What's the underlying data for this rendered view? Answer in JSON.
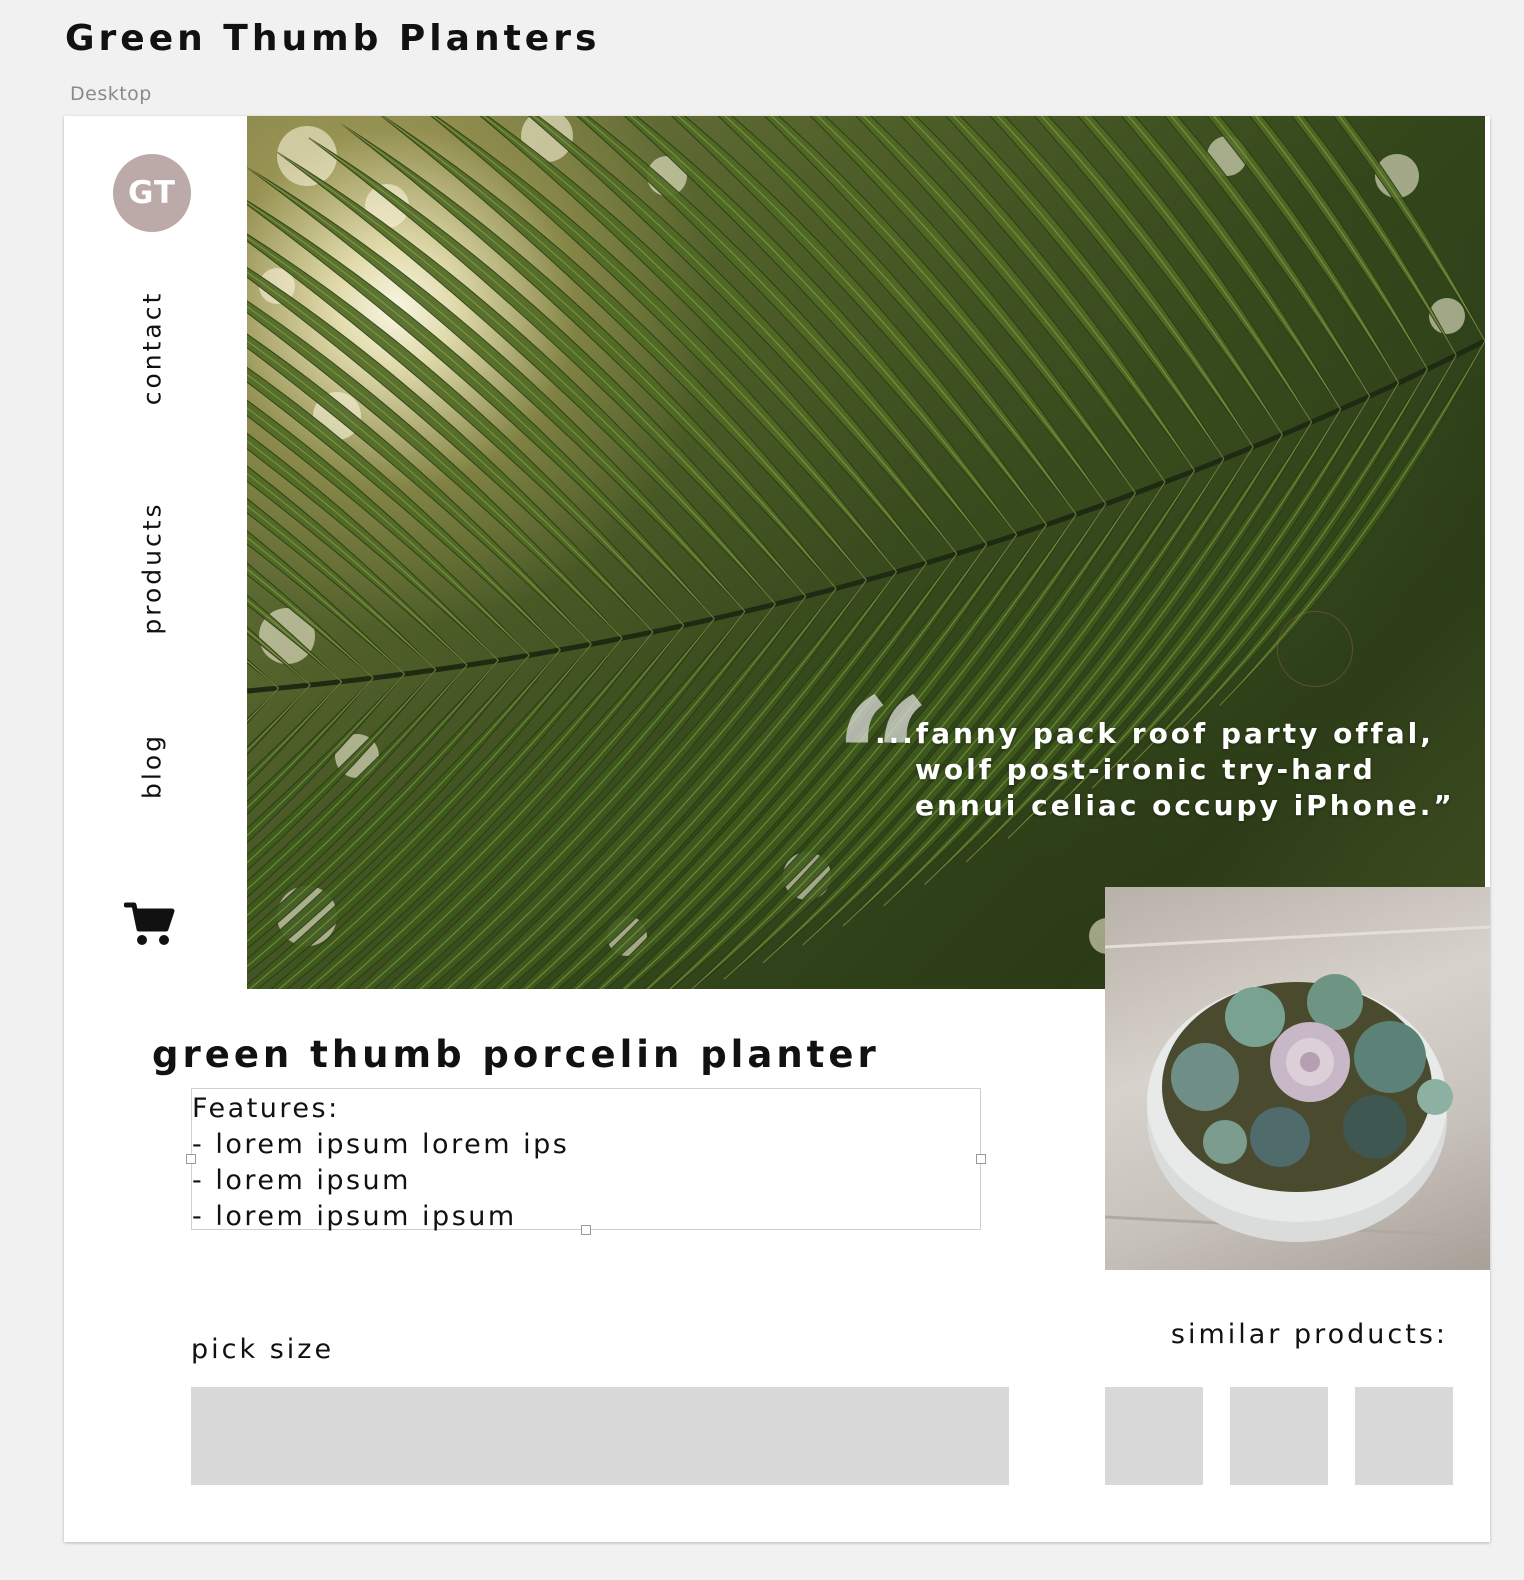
{
  "project": {
    "title": "Green Thumb Planters",
    "artboard_label": "Desktop"
  },
  "site": {
    "logo_text": "GT",
    "logo_color": "#bcaaa8",
    "nav": {
      "contact": "contact",
      "products": "products",
      "blog": "blog"
    },
    "cart_icon": "shopping-cart-icon"
  },
  "hero": {
    "quote_lines": [
      "...fanny pack roof party offal,",
      "wolf post-ironic try-hard",
      "ennui celiac occupy iPhone.”"
    ],
    "quote_mark": "“"
  },
  "product": {
    "title": "green thumb porcelin planter",
    "features": [
      "Features:",
      "- lorem ipsum lorem ips",
      "- lorem ipsum",
      "- lorem ipsum ipsum"
    ],
    "pick_size_label": "pick size",
    "similar_label": "similar products:",
    "placeholder_color": "#d8d8d8"
  }
}
